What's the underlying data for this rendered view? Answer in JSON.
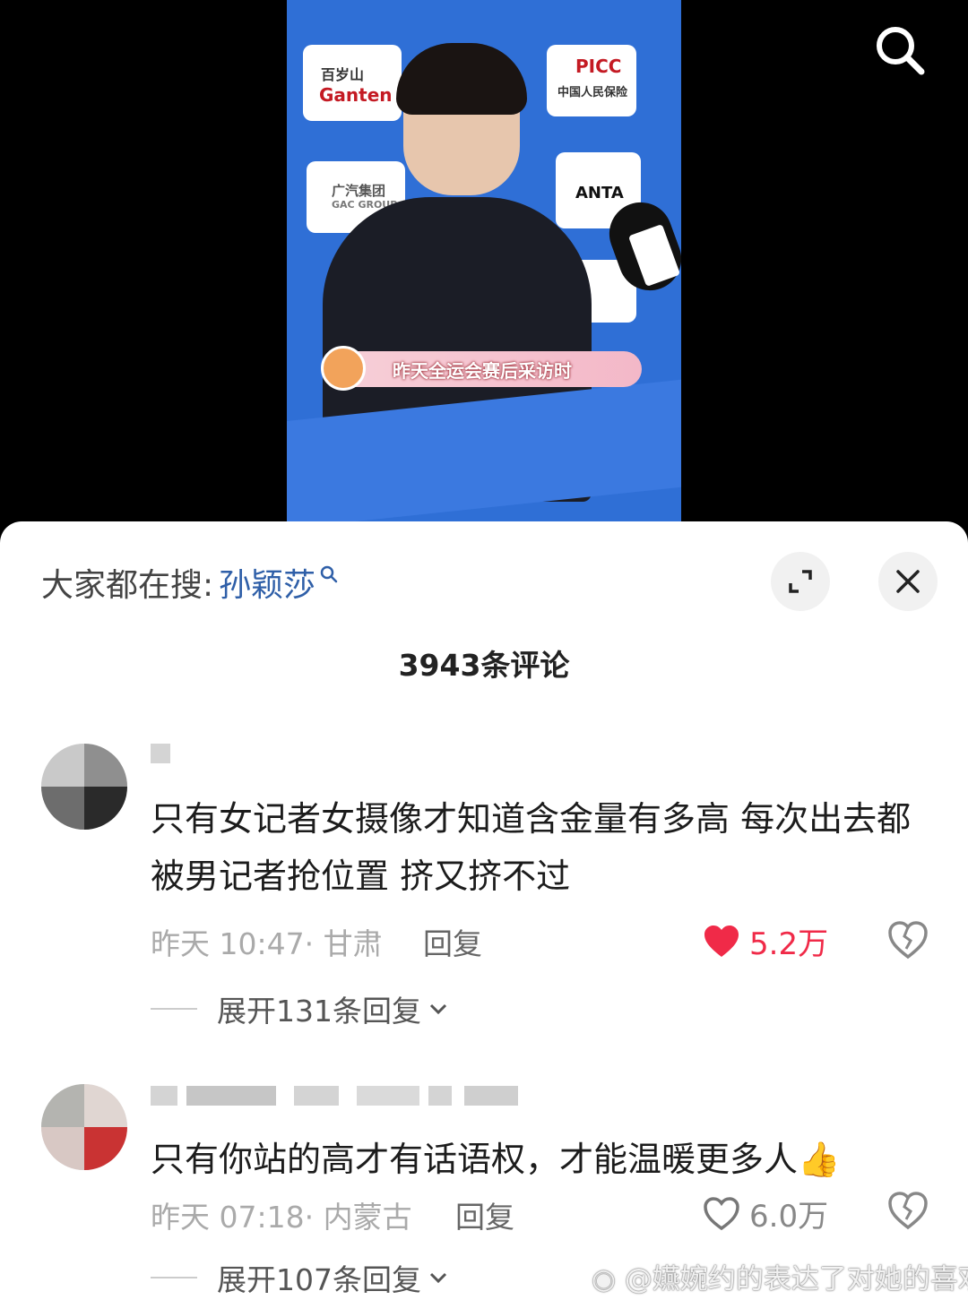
{
  "video": {
    "caption": "昨天全运会赛后采访时",
    "sponsors": [
      "百岁山",
      "Ganten",
      "PICC",
      "中国人民保险",
      "广汽集团",
      "GAC GROUP",
      "ANTA"
    ]
  },
  "sheet": {
    "trending_prefix": "大家都在搜:",
    "trending_term": "孙颖莎",
    "comment_count_title": "3943条评论"
  },
  "comments": [
    {
      "text": "只有女记者女摄像才知道含金量有多高 每次出去都被男记者抢位置 挤又挤不过",
      "time": "昨天 10:47",
      "location": "· 甘肃",
      "reply_label": "回复",
      "likes": "5.2万",
      "liked": true,
      "expand_label": "展开131条回复"
    },
    {
      "text": "只有你站的高才有话语权，才能温暖更多人👍",
      "time": "昨天 07:18",
      "location": "· 内蒙古",
      "reply_label": "回复",
      "likes": "6.0万",
      "liked": false,
      "expand_label": "展开107条回复"
    }
  ],
  "watermark": "@嬿婉约的表达了对她的喜欢",
  "colors": {
    "like_red": "#f02a48",
    "link_blue": "#2f5fa8"
  },
  "icons": [
    "search-icon",
    "magnifier-small-icon",
    "expand-icon",
    "close-icon",
    "heart-filled-icon",
    "heart-outline-icon",
    "broken-heart-icon",
    "chevron-down-icon",
    "weibo-icon"
  ]
}
